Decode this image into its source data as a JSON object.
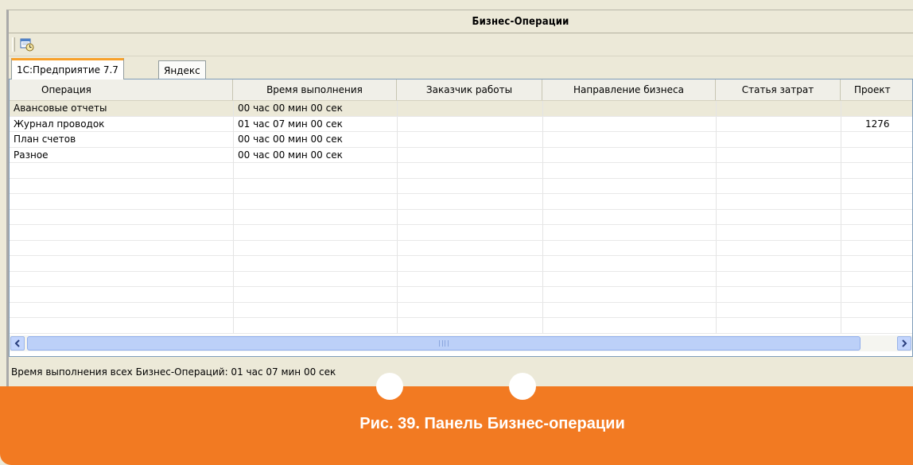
{
  "window": {
    "title": "Бизнес-Операции"
  },
  "toolbar": {
    "refresh_icon": "calendar-clock-icon"
  },
  "tabs": [
    {
      "label": "1С:Предприятие 7.7",
      "active": true
    },
    {
      "label": "Яндекс",
      "active": false
    }
  ],
  "table": {
    "columns": [
      "Операция",
      "Время выполнения",
      "Заказчик работы",
      "Направление бизнеса",
      "Статья затрат",
      "Проект"
    ],
    "rows": [
      [
        "Авансовые отчеты",
        "00 час 00 мин 00 сек",
        "",
        "",
        "",
        ""
      ],
      [
        "Журнал проводок",
        "01 час 07 мин 00 сек",
        "",
        "",
        "",
        "1276"
      ],
      [
        "План счетов",
        "00 час 00 мин 00 сек",
        "",
        "",
        "",
        ""
      ],
      [
        "Разное",
        "00 час 00 мин 00 сек",
        "",
        "",
        "",
        ""
      ]
    ]
  },
  "status": {
    "text": "Время выполнения всех Бизнес-Операций: 01 час 07 мин 00 сек"
  },
  "caption": {
    "text": "Рис. 39. Панель Бизнес-операции"
  },
  "colors": {
    "accent": "#f27a22",
    "tab_highlight": "#f7a12b",
    "scroll": "#bcd0f8"
  }
}
